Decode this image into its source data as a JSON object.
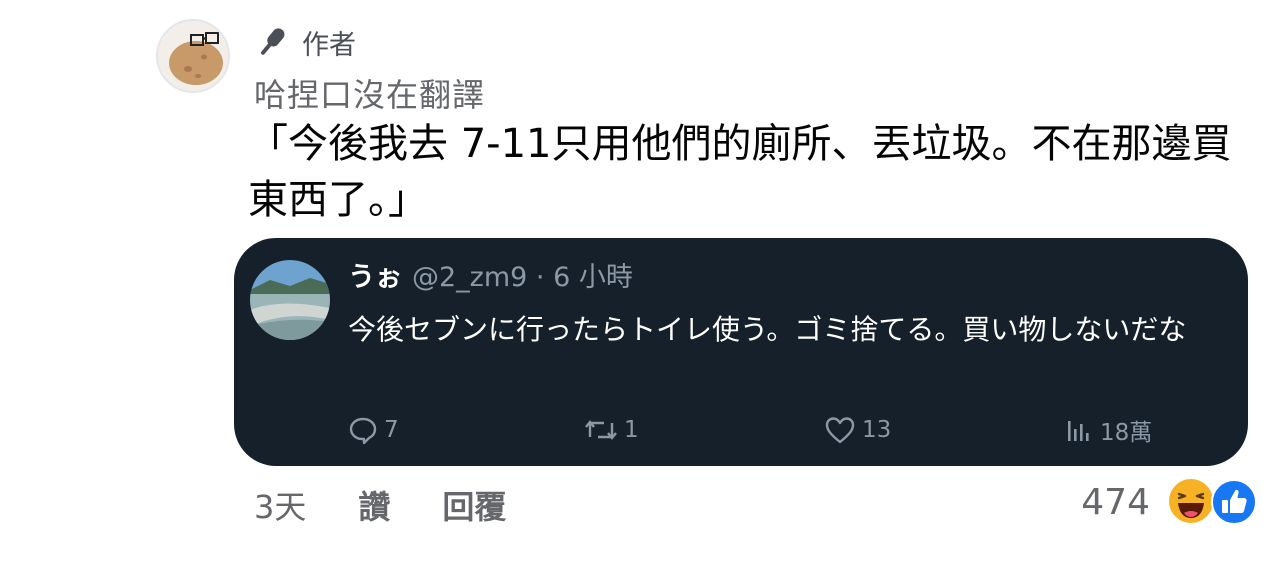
{
  "comment": {
    "author_badge": "作者",
    "name": "哈捏口沒在翻譯",
    "text": "「今後我去 7-11只用他們的廁所、丟垃圾。不在那邊買東西了。」",
    "footer": {
      "time": "3天",
      "like_label": "讚",
      "reply_label": "回覆"
    },
    "reactions": {
      "count": "474",
      "types": [
        "haha-icon",
        "like-icon"
      ]
    }
  },
  "embedded_tweet": {
    "display_name": "うぉ",
    "handle_time": "@2_zm9 · 6 小時",
    "body": "今後セブンに行ったらトイレ使う。ゴミ捨てる。買い物しないだな",
    "actions": {
      "replies": "7",
      "retweets": "1",
      "likes": "13",
      "views": "18萬"
    }
  },
  "colors": {
    "card_bg": "#15202b",
    "muted_text": "#65676b",
    "tweet_muted": "#8b98a5",
    "like_blue": "#1877f2"
  }
}
